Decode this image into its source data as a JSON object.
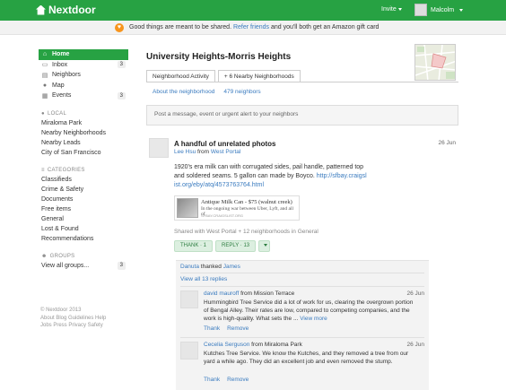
{
  "topbar": {
    "brand": "Nextdoor",
    "invite": "Invite",
    "user_name": "Malcolm"
  },
  "promo": {
    "before": "Good things are meant to be shared.",
    "link": "Refer friends",
    "after": "and you'll both get an Amazon gift card"
  },
  "sidebar": {
    "nav": [
      {
        "label": "Home",
        "icon": "home-icon",
        "count": ""
      },
      {
        "label": "Inbox",
        "icon": "inbox-icon",
        "count": "3"
      },
      {
        "label": "Neighbors",
        "icon": "neighbors-icon",
        "count": ""
      },
      {
        "label": "Map",
        "icon": "map-pin-icon",
        "count": ""
      },
      {
        "label": "Events",
        "icon": "calendar-icon",
        "count": "3"
      }
    ],
    "local_heading": "LOCAL",
    "local": [
      "Miraloma Park",
      "Nearby Neighborhoods",
      "Nearby Leads",
      "City of San Francisco"
    ],
    "categories_heading": "CATEGORIES",
    "categories": [
      "Classifieds",
      "Crime & Safety",
      "Documents",
      "Free items",
      "General",
      "Lost & Found",
      "Recommendations"
    ],
    "groups_heading": "GROUPS",
    "groups_item": "View all groups...",
    "groups_count": "3"
  },
  "footer": {
    "line1": "© Nextdoor 2013",
    "line2": "About  Blog  Guidelines  Help",
    "line3": "Jobs  Press  Privacy  Safety"
  },
  "main": {
    "title": "University Heights-Morris Heights",
    "tabs": [
      "Neighborhood Activity",
      "+ 6 Nearby Neighborhoods"
    ],
    "subtabs": [
      "About the neighborhood",
      "479 neighbors"
    ],
    "post_placeholder": "Post a message, event or urgent alert to your neighbors"
  },
  "post": {
    "title": "A handful of unrelated photos",
    "author": "Lee Hsu",
    "from_word": "from",
    "location": "West Portal",
    "date": "26 Jun",
    "body": "1920's era milk can with corrugated sides, pail handle, patterned top and soldered seams. 5 gallon can made by Boyco.",
    "link": "http://sfbay.craigslist.org/eby/atq/4573763764.html",
    "card": {
      "title": "Antique Milk Can - $75 (walnut creek)",
      "desc": "In the ongoing war between Uber, Lyft, and all of",
      "url": "SFBAY.CRAIGSLIST.ORG"
    },
    "shared": "Shared with West Portal + 12 neighborhoods in General",
    "thank": "THANK · 1",
    "reply": "REPLY · 13"
  },
  "comments": {
    "thanked_user": "Danuta",
    "thanked_word": "thanked",
    "thanked_target": "James",
    "view_all": "View all 13 replies",
    "items": [
      {
        "author": "david mauroff",
        "from": "from Mission Terrace",
        "date": "26 Jun",
        "body": "Hummingbird Tree Service did a lot of work for us, clearing the overgrown portion of Bengal Alley. Their rates are low, compared to competing companies, and the work is high-quality. What sets the ...",
        "more": "View more",
        "thank": "Thank",
        "remove": "Remove"
      },
      {
        "author": "Cecelia Serguson",
        "from": "from Miraloma Park",
        "date": "26 Jun",
        "body": "Kutches Tree Service. We know the Kutches, and they removed a tree from our yard a while ago. They did an excellent job and even removed the stump.",
        "more": "",
        "thank": "Thank",
        "remove": "Remove"
      }
    ]
  }
}
